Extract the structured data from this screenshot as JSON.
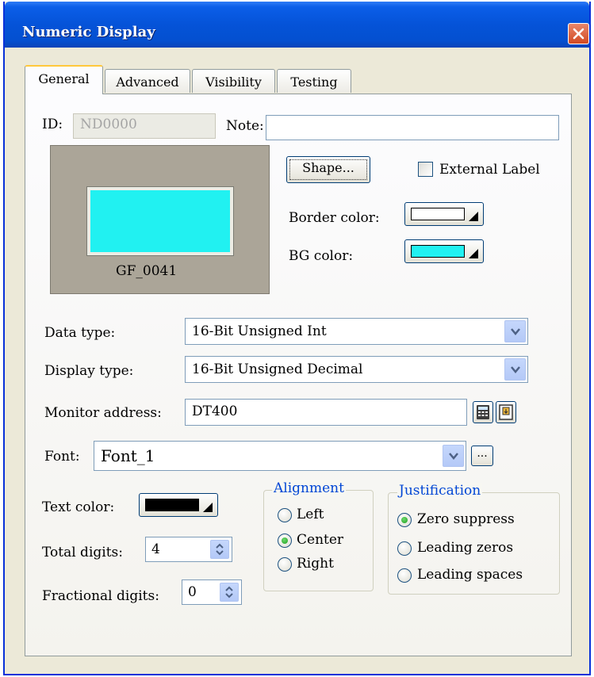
{
  "window": {
    "title": "Numeric Display"
  },
  "tabs": [
    {
      "label": "General",
      "active": true
    },
    {
      "label": "Advanced",
      "active": false
    },
    {
      "label": "Visibility",
      "active": false
    },
    {
      "label": "Testing",
      "active": false
    }
  ],
  "id_field": {
    "label": "ID:",
    "value": "ND0000"
  },
  "note_field": {
    "label": "Note:",
    "value": ""
  },
  "preview": {
    "caption": "GF_0041",
    "shape_color": "#21f1f1"
  },
  "shape_button": {
    "label": "Shape..."
  },
  "external_label": {
    "label": "External Label",
    "checked": false
  },
  "border_color": {
    "label": "Border color:",
    "value": "#ffffff"
  },
  "bg_color": {
    "label": "BG color:",
    "value": "#21f1f1"
  },
  "data_type": {
    "label": "Data type:",
    "value": "16-Bit Unsigned Int"
  },
  "display_type": {
    "label": "Display type:",
    "value": "16-Bit Unsigned Decimal"
  },
  "monitor_address": {
    "label": "Monitor address:",
    "value": "DT400"
  },
  "font": {
    "label": "Font:",
    "value": "Font_1",
    "browse_label": "..."
  },
  "text_color": {
    "label": "Text color:",
    "value": "#000000"
  },
  "total_digits": {
    "label": "Total digits:",
    "value": "4"
  },
  "fractional_digits": {
    "label": "Fractional digits:",
    "value": "0"
  },
  "alignment": {
    "title": "Alignment",
    "options": [
      "Left",
      "Center",
      "Right"
    ],
    "selected": "Center"
  },
  "justification": {
    "title": "Justification",
    "options": [
      "Zero suppress",
      "Leading zeros",
      "Leading spaces"
    ],
    "selected": "Zero suppress"
  }
}
